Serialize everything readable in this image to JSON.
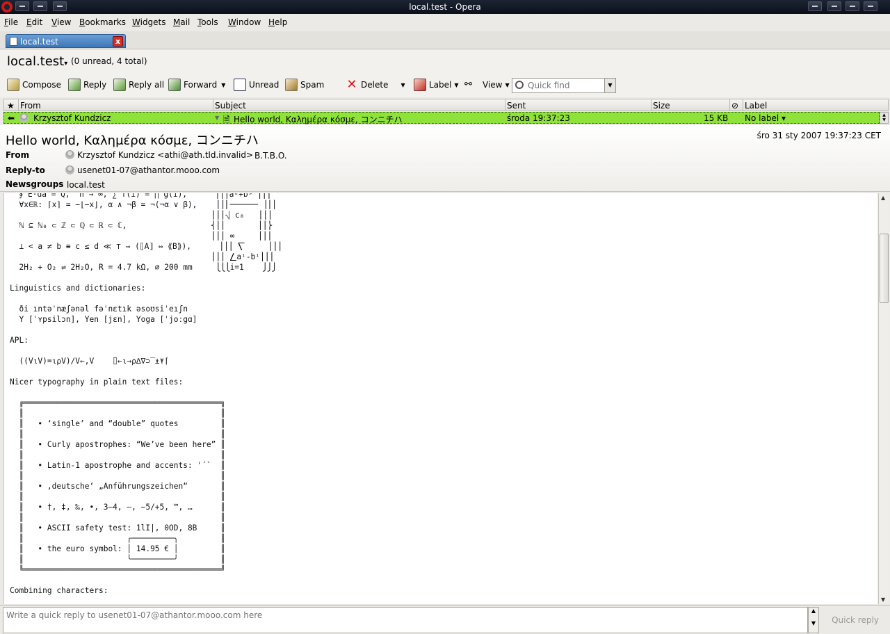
{
  "window": {
    "title": "local.test - Opera"
  },
  "menu": [
    {
      "label": "File",
      "u": "F",
      "rest": "ile"
    },
    {
      "label": "Edit",
      "u": "E",
      "rest": "dit"
    },
    {
      "label": "View",
      "u": "V",
      "rest": "iew"
    },
    {
      "label": "Bookmarks",
      "u": "B",
      "rest": "ookmarks"
    },
    {
      "label": "Widgets",
      "u": "W",
      "rest": "idgets"
    },
    {
      "label": "Mail",
      "u": "M",
      "rest": "ail"
    },
    {
      "label": "Tools",
      "u": "T",
      "rest": "ools"
    },
    {
      "label": "Window",
      "u": "W",
      "rest": "indow"
    },
    {
      "label": "Help",
      "u": "H",
      "rest": "elp"
    }
  ],
  "tab": {
    "label": "local.test",
    "close": "x"
  },
  "folder": {
    "title": "local.test",
    "dropdown": "▾",
    "counts": "(0 unread, 4 total)"
  },
  "toolbar": {
    "compose": "Compose",
    "reply": "Reply",
    "reply_all": "Reply all",
    "forward": "Forward",
    "unread": "Unread",
    "spam": "Spam",
    "delete": "Delete",
    "label": "Label",
    "view": "View",
    "quickfind_placeholder": "Quick find"
  },
  "list": {
    "columns": {
      "star": "★",
      "from": "From",
      "subject": "Subject",
      "sent": "Sent",
      "size": "Size",
      "label": "Label"
    },
    "row": {
      "from": "Krzysztof Kundzicz",
      "subject": "Hello world, Καλημέρα κόσμε, コンニチハ",
      "sent": "środa 19:37:23",
      "size": "15 KB",
      "label": "No label ▾"
    }
  },
  "message": {
    "subject": "Hello world, Καλημέρα κόσμε, コンニチハ",
    "date": "śro 31 sty 2007 19:37:23 CET",
    "from_label": "From",
    "from_value": "Krzysztof Kundzicz <athi@ath.tld.invalid>",
    "from_extra": "B.T.B.O.",
    "replyto_label": "Reply-to",
    "replyto_value": "usenet01-07@athantor.mooo.com",
    "newsgroups_label": "Newsgroups",
    "newsgroups_value": "local.test",
    "body": "  ∮ E⋅da = Q,  n → ∞, ∑ f(i) = ∏ g(i),      ⎪⎪⎪a²+b³ ⎪⎪⎪\n  ∀x∈ℝ: ⌈x⌉ = −⌊−x⌋, α ∧ ¬β = ¬(¬α ∨ β),    ⎪⎪⎜────── ⎟⎪⎪\n                                           ⎪⎪⎪⎷ c₈   ⎪⎪⎪\n  ℕ ⊆ ℕ₀ ⊂ ℤ ⊂ ℚ ⊂ ℝ ⊂ ℂ,                  ⎨⎪⎪       ⎪⎪⎬\n                                           ⎪⎪⎪ ∞     ⎪⎪⎪\n  ⊥ < a ≠ b ≡ c ≤ d ≪ ⊤ ⇒ (⟦A⟧ ⇔ ⟪B⟫),      ⎪⎪⎪ ⎲     ⎪⎪⎪\n                                           ⎪⎪⎪ ⎳aⁱ-bⁱ⎪⎪⎪\n  2H₂ + O₂ ⇌ 2H₂O, R = 4.7 kΩ, ⌀ 200 mm     ⎩⎩⎩i=1    ⎭⎭⎭\n\nLinguistics and dictionaries:\n\n  ði ıntəˈnæʃənəl fəˈnɛtık əsoʊsiˈeıʃn\n  Y [ˈʏpsilɔn], Yen [jɛn], Yoga [ˈjoːgɑ]\n\nAPL:\n\n  ((V⍳V)=⍳⍴V)/V←,V    ⌷←⍳→⍴∆∇⊃‾⍎⍕⌈\n\nNicer typography in plain text files:\n\n  ╔══════════════════════════════════════════╗\n  ║                                          ║\n  ║   • ‘single’ and “double” quotes         ║\n  ║                                          ║\n  ║   • Curly apostrophes: “We’ve been here” ║\n  ║                                          ║\n  ║   • Latin-1 apostrophe and accents: '´`  ║\n  ║                                          ║\n  ║   • ‚deutsche‘ „Anführungszeichen“       ║\n  ║                                          ║\n  ║   • †, ‡, ‰, •, 3–4, —, −5/+5, ™, …      ║\n  ║                                          ║\n  ║   • ASCII safety test: 1lI|, 0OD, 8B     ║\n  ║                      ╭─────────╮         ║\n  ║   • the euro symbol: │ 14.95 € │         ║\n  ║                      ╰─────────╯         ║\n  ╚══════════════════════════════════════════╝\n\nCombining characters:\n"
  },
  "quickreply": {
    "placeholder": "Write a quick reply to usenet01-07@athantor.mooo.com here",
    "button": "Quick reply"
  }
}
